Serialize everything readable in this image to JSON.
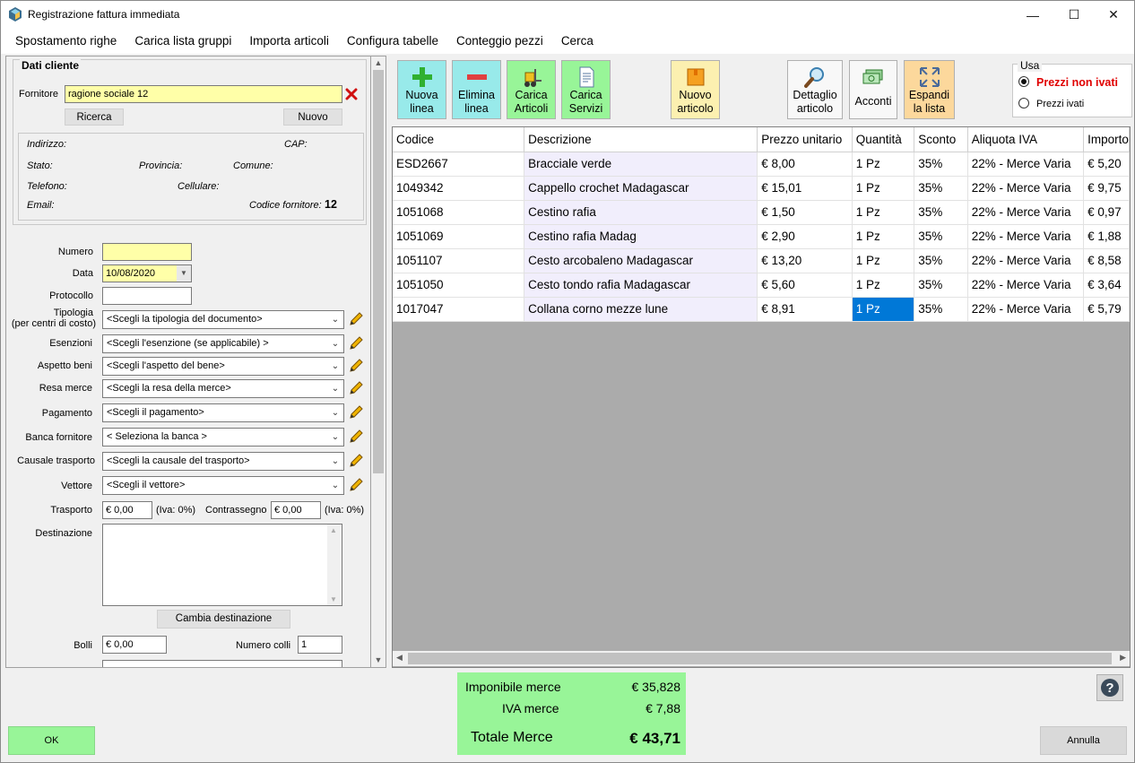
{
  "window": {
    "title": "Registrazione fattura immediata",
    "minimize": "—",
    "maximize": "☐",
    "close": "✕"
  },
  "menu": [
    "Spostamento righe",
    "Carica lista gruppi",
    "Importa articoli",
    "Configura tabelle",
    "Conteggio pezzi",
    "Cerca"
  ],
  "cliente": {
    "legend": "Dati cliente",
    "fornitore_label": "Fornitore",
    "fornitore_value": "ragione sociale 12",
    "ricerca": "Ricerca",
    "nuovo": "Nuovo",
    "indirizzo": "Indirizzo:",
    "cap": "CAP:",
    "stato": "Stato:",
    "provincia": "Provincia:",
    "comune": "Comune:",
    "telefono": "Telefono:",
    "cellulare": "Cellulare:",
    "email": "Email:",
    "codice_label": "Codice fornitore:",
    "codice_value": "12"
  },
  "form": {
    "numero_label": "Numero",
    "numero_value": "",
    "data_label": "Data",
    "data_value": "10/08/2020",
    "protocollo_label": "Protocollo",
    "protocollo_value": "",
    "tipologia_label_1": "Tipologia",
    "tipologia_label_2": "(per centri di costo)",
    "tipologia_value": "<Scegli la tipologia del documento>",
    "esenzioni_label": "Esenzioni",
    "esenzioni_value": "<Scegli l'esenzione (se applicabile) >",
    "aspetto_label": "Aspetto beni",
    "aspetto_value": "<Scegli l'aspetto del bene>",
    "resa_label": "Resa merce",
    "resa_value": "<Scegli la resa della merce>",
    "pagamento_label": "Pagamento",
    "pagamento_value": "<Scegli il pagamento>",
    "banca_label": "Banca fornitore",
    "banca_value": "< Seleziona la banca >",
    "causale_label": "Causale trasporto",
    "causale_value": "<Scegli la causale del trasporto>",
    "vettore_label": "Vettore",
    "vettore_value": "<Scegli il vettore>",
    "trasporto_label": "Trasporto",
    "trasporto_value": "€ 0,00",
    "trasporto_iva": "(Iva: 0%)",
    "contrassegno_label": "Contrassegno",
    "contrassegno_value": "€ 0,00",
    "contrassegno_iva": "(Iva: 0%)",
    "destinazione_label": "Destinazione",
    "destinazione_value": "",
    "cambia_destinazione": "Cambia destinazione",
    "bolli_label": "Bolli",
    "bolli_value": "€ 0,00",
    "colli_label": "Numero colli",
    "colli_value": "1"
  },
  "toolbar": {
    "nuova_linea": [
      "Nuova",
      "linea"
    ],
    "elimina_linea": [
      "Elimina",
      "linea"
    ],
    "carica_articoli": [
      "Carica",
      "Articoli"
    ],
    "carica_servizi": [
      "Carica",
      "Servizi"
    ],
    "nuovo_articolo": [
      "Nuovo",
      "articolo"
    ],
    "dettaglio_articolo": [
      "Dettaglio",
      "articolo"
    ],
    "acconti": "Acconti",
    "espandi_lista": [
      "Espandi",
      "la lista"
    ],
    "usa_label": "Usa",
    "prezzi_non_ivati": "Prezzi non ivati",
    "prezzi_ivati": "Prezzi ivati",
    "selected_price_mode": "Prezzi non ivati"
  },
  "grid": {
    "columns": [
      "Codice",
      "Descrizione",
      "Prezzo unitario",
      "Quantità",
      "Sconto",
      "Aliquota IVA",
      "Importo"
    ],
    "rows": [
      [
        "ESD2667",
        "Bracciale verde",
        "€ 8,00",
        "1 Pz",
        "35%",
        "22% - Merce Varia",
        "€ 5,20"
      ],
      [
        "1049342",
        "Cappello crochet Madagascar",
        "€ 15,01",
        "1 Pz",
        "35%",
        "22% - Merce Varia",
        "€ 9,75"
      ],
      [
        "1051068",
        "Cestino rafia",
        "€ 1,50",
        "1 Pz",
        "35%",
        "22% - Merce Varia",
        "€ 0,97"
      ],
      [
        "1051069",
        "Cestino rafia Madag",
        "€ 2,90",
        "1 Pz",
        "35%",
        "22% - Merce Varia",
        "€ 1,88"
      ],
      [
        "1051107",
        "Cesto arcobaleno Madagascar",
        "€ 13,20",
        "1 Pz",
        "35%",
        "22% - Merce Varia",
        "€ 8,58"
      ],
      [
        "1051050",
        "Cesto tondo rafia Madagascar",
        "€ 5,60",
        "1 Pz",
        "35%",
        "22% - Merce Varia",
        "€ 3,64"
      ],
      [
        "1017047",
        "Collana corno mezze lune",
        "€ 8,91",
        "1 Pz",
        "35%",
        "22% - Merce Varia",
        "€ 5,79"
      ]
    ]
  },
  "totals": {
    "imponibile_label": "Imponibile merce",
    "imponibile_value": "€ 35,828",
    "iva_label": "IVA merce",
    "iva_value": "€ 7,88",
    "totale_label": "Totale Merce",
    "totale_value": "€ 43,71"
  },
  "footer": {
    "ok": "OK",
    "annulla": "Annulla",
    "help": "?"
  },
  "colors": {
    "yellow_field": "#ffffa8",
    "green": "#98f598",
    "teal_button": "#98eaea",
    "orange_button": "#fcd89c",
    "selection": "#0078d7",
    "red_text": "#e00000"
  }
}
